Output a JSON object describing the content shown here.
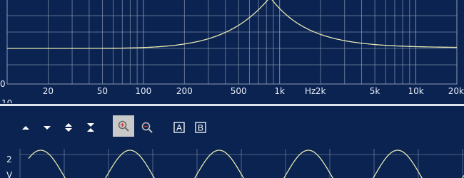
{
  "frequency_plot": {
    "x_ticks": [
      "10",
      "20",
      "50",
      "100",
      "200",
      "500",
      "1k",
      "2k",
      "5k",
      "10k",
      "20k"
    ],
    "x_unit": "Hz",
    "y_partial_labels": [
      "0",
      "00"
    ],
    "colors": {
      "background": "#0a2350",
      "grid": "#8f9bb6",
      "curve": "#e5e9b2"
    }
  },
  "toolbar": {
    "buttons": [
      {
        "icon": "arrow-up-icon",
        "name": "scroll-up-button"
      },
      {
        "icon": "arrow-down-icon",
        "name": "scroll-down-button"
      },
      {
        "icon": "expand-vertical-icon",
        "name": "expand-vertical-button"
      },
      {
        "icon": "collapse-vertical-icon",
        "name": "collapse-vertical-button"
      },
      {
        "icon": "zoom-in-icon",
        "name": "zoom-in-button",
        "selected": true
      },
      {
        "icon": "zoom-out-icon",
        "name": "zoom-out-button"
      },
      {
        "icon": "channel-a-icon",
        "name": "channel-a-button",
        "label": "A"
      },
      {
        "icon": "channel-b-icon",
        "name": "channel-b-button",
        "label": "B"
      }
    ]
  },
  "waveform_plot": {
    "y_label": "2",
    "y_unit": "V",
    "colors": {
      "curve": "#e5e9b2"
    }
  }
}
